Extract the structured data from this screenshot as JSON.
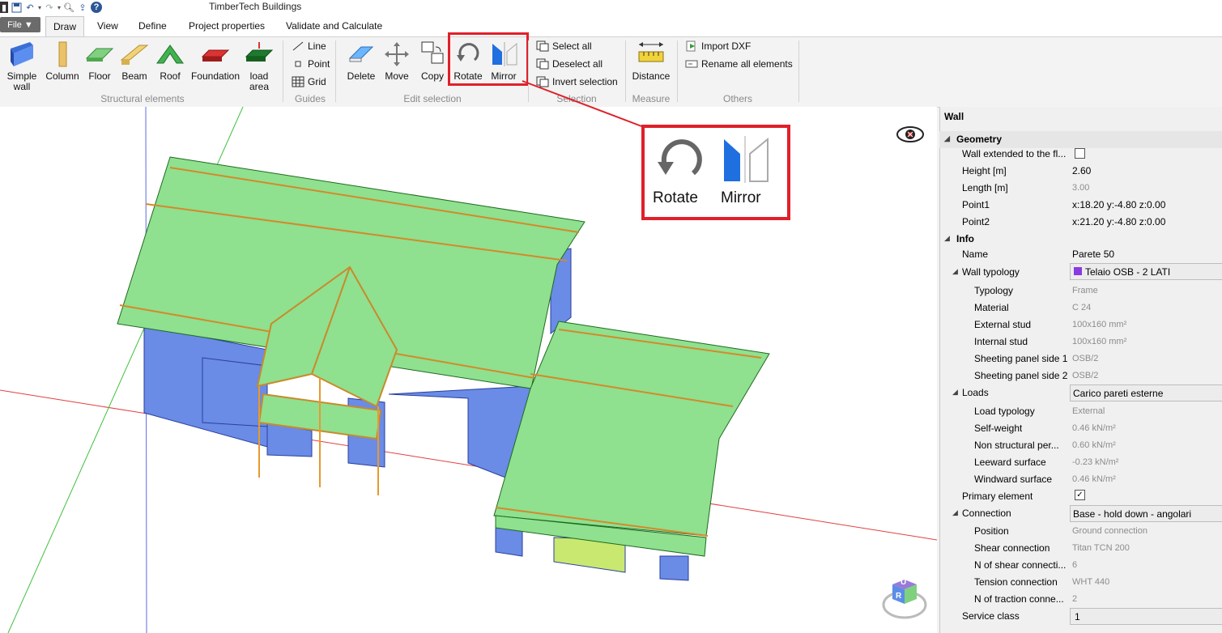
{
  "app": {
    "title": "TimberTech Buildings"
  },
  "tabs": {
    "file": "File ▼",
    "draw": "Draw",
    "view": "View",
    "define": "Define",
    "project": "Project properties",
    "validate": "Validate and Calculate"
  },
  "ribbon": {
    "structural": {
      "simple_wall": "Simple",
      "simple_wall2": "wall",
      "column": "Column",
      "floor": "Floor",
      "beam": "Beam",
      "roof": "Roof",
      "foundation": "Foundation",
      "load_area": "load",
      "load_area2": "area",
      "group_label": "Structural elements"
    },
    "guides": {
      "line": "Line",
      "point": "Point",
      "grid": "Grid",
      "group_label": "Guides"
    },
    "edit": {
      "delete": "Delete",
      "move": "Move",
      "copy": "Copy",
      "rotate": "Rotate",
      "mirror": "Mirror",
      "group_label": "Edit selection"
    },
    "selection": {
      "select_all": "Select all",
      "deselect_all": "Deselect all",
      "invert": "Invert selection",
      "group_label": "Selection"
    },
    "measure": {
      "distance": "Distance",
      "group_label": "Measure"
    },
    "others": {
      "import_dxf": "Import DXF",
      "rename_all": "Rename all elements",
      "group_label": "Others"
    }
  },
  "zoom_callout": {
    "rotate": "Rotate",
    "mirror": "Mirror"
  },
  "navcube": {
    "top": "U",
    "front": "R"
  },
  "panel": {
    "title": "Wall",
    "geometry_label": "Geometry",
    "wall_extended": "Wall extended to the fl...",
    "height_label": "Height [m]",
    "height": "2.60",
    "length_label": "Length [m]",
    "length": "3.00",
    "point1_label": "Point1",
    "point1": "x:18.20 y:-4.80 z:0.00",
    "point2_label": "Point2",
    "point2": "x:21.20 y:-4.80 z:0.00",
    "info_label": "Info",
    "name_label": "Name",
    "name": "Parete 50",
    "wall_typology_label": "Wall typology",
    "wall_typology": "Telaio OSB - 2 LATI",
    "typology_label": "Typology",
    "typology": "Frame",
    "material_label": "Material",
    "material": "C 24",
    "ext_stud_label": "External stud",
    "ext_stud": "100x160 mm²",
    "int_stud_label": "Internal stud",
    "int_stud": "100x160 mm²",
    "sheet1_label": "Sheeting panel side 1",
    "sheet1": "OSB/2",
    "sheet2_label": "Sheeting panel side 2",
    "sheet2": "OSB/2",
    "loads_label": "Loads",
    "loads": "Carico pareti esterne",
    "load_typ_label": "Load typology",
    "load_typ": "External",
    "self_weight_label": "Self-weight",
    "self_weight": "0.46 kN/m²",
    "non_struct_label": "Non structural per...",
    "non_struct": "0.60 kN/m²",
    "leeward_label": "Leeward surface",
    "leeward": "-0.23 kN/m²",
    "windward_label": "Windward surface",
    "windward": "0.46 kN/m²",
    "primary_label": "Primary element",
    "connection_label": "Connection",
    "connection": "Base - hold down - angolari",
    "position_label": "Position",
    "position": "Ground connection",
    "shear_label": "Shear connection",
    "shear": "Titan TCN 200",
    "n_shear_label": "N of shear connecti...",
    "n_shear": "6",
    "tension_label": "Tension connection",
    "tension": "WHT 440",
    "n_traction_label": "N of traction conne...",
    "n_traction": "2",
    "service_label": "Service class",
    "service": "1"
  },
  "colors": {
    "roof": "#8fe08f",
    "wall": "#6a8be6",
    "beam": "#e69a2e",
    "highlight": "#e0202a"
  }
}
